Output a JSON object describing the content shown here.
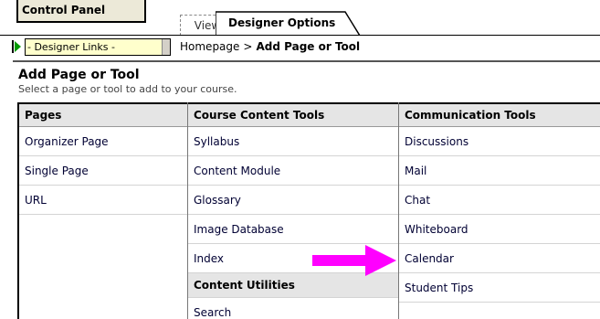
{
  "topbar": {
    "control_panel_label": "Control Panel",
    "tabs": [
      {
        "label": "View",
        "active": false
      },
      {
        "label": "Designer Options",
        "active": true
      }
    ]
  },
  "nav": {
    "designer_links_select": "- Designer Links -",
    "breadcrumb": {
      "home": "Homepage",
      "separator": ">",
      "current": "Add Page or Tool"
    }
  },
  "header": {
    "title": "Add Page or Tool",
    "subtitle": "Select a page or tool to add to your course."
  },
  "columns": [
    {
      "heading": "Pages",
      "items": [
        "Organizer Page",
        "Single Page",
        "URL"
      ]
    },
    {
      "heading": "Course Content Tools",
      "items": [
        "Syllabus",
        "Content Module",
        "Glossary",
        "Image Database",
        "Index"
      ],
      "subsection": {
        "heading": "Content Utilities",
        "items": [
          "Search"
        ]
      }
    },
    {
      "heading": "Communication Tools",
      "items": [
        "Discussions",
        "Mail",
        "Chat",
        "Whiteboard",
        "Calendar",
        "Student Tips"
      ]
    }
  ],
  "colors": {
    "highlight_arrow": "#ff00ff",
    "nav_arrow": "#009900",
    "select_bg": "#ffffcc",
    "header_bg": "#e5e5e5"
  },
  "icons": {
    "nav_arrow": "play-triangle",
    "pointer": "right-arrow"
  }
}
